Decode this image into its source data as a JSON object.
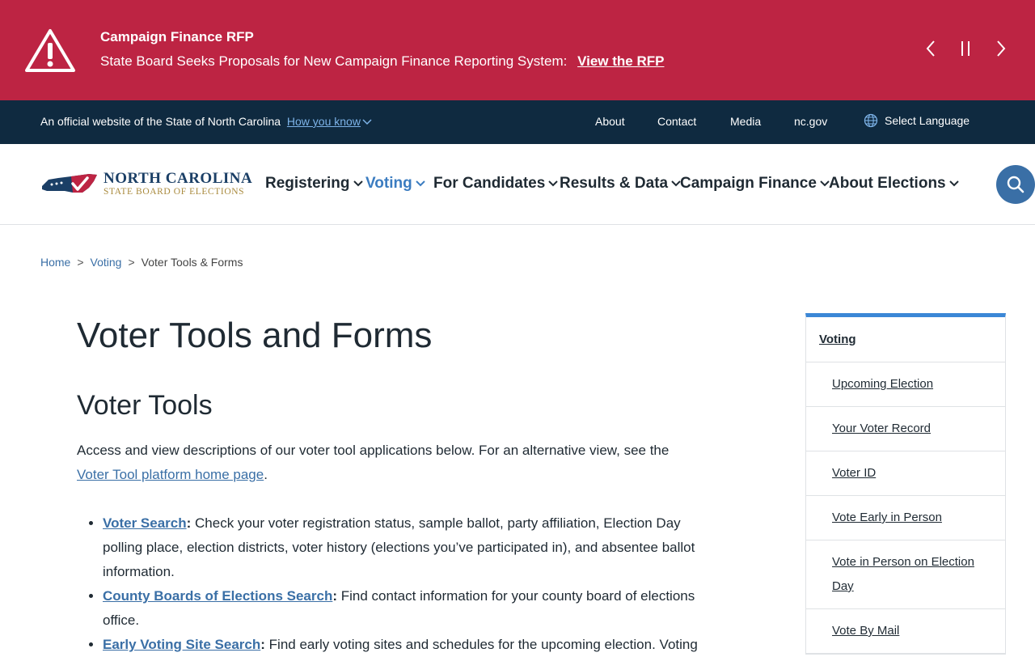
{
  "alert": {
    "title": "Campaign Finance RFP",
    "body": "State Board Seeks Proposals for New Campaign Finance Reporting System:",
    "link": "View the RFP"
  },
  "utility": {
    "official": "An official website of the State of North Carolina",
    "how_you_know": "How you know",
    "links": [
      "About",
      "Contact",
      "Media",
      "nc.gov"
    ],
    "language": "Select Language"
  },
  "logo": {
    "name": "NORTH CAROLINA",
    "sub": "STATE BOARD OF ELECTIONS"
  },
  "nav": {
    "items": [
      {
        "label": "Registering",
        "active": false
      },
      {
        "label": "Voting",
        "active": true
      },
      {
        "label": "For Candidates",
        "active": false
      },
      {
        "label": "Results & Data",
        "active": false
      },
      {
        "label": "Campaign Finance",
        "active": false
      },
      {
        "label": "About Elections",
        "active": false
      }
    ]
  },
  "breadcrumb": {
    "home": "Home",
    "voting": "Voting",
    "current": "Voter Tools & Forms"
  },
  "main": {
    "title": "Voter Tools and Forms",
    "section_title": "Voter Tools",
    "intro_text": "Access and view descriptions of our voter tool applications below. For an alternative view, see the",
    "intro_link": "Voter Tool platform home page",
    "tools": [
      {
        "link": "Voter Search",
        "desc": " Check your voter registration status, sample ballot, party affiliation, Election Day polling place, election districts, voter history (elections you’ve participated in), and absentee ballot information."
      },
      {
        "link": "County Boards of Elections Search",
        "desc": " Find contact information for your county board of elections office."
      },
      {
        "link": "Early Voting Site Search",
        "desc": " Find early voting sites and schedules for the upcoming election. Voting"
      }
    ]
  },
  "sidebar": {
    "heading": "Voting",
    "items": [
      "Upcoming Election",
      "Your Voter Record",
      "Voter ID",
      "Vote Early in Person",
      "Vote in Person on Election Day",
      "Vote By Mail"
    ]
  },
  "colors": {
    "alert_bg": "#bd2443",
    "utility_bg": "#0f2a40",
    "link": "#3a6fa6",
    "active_nav": "#3b7cc0",
    "sidebar_accent": "#3b87d6"
  }
}
